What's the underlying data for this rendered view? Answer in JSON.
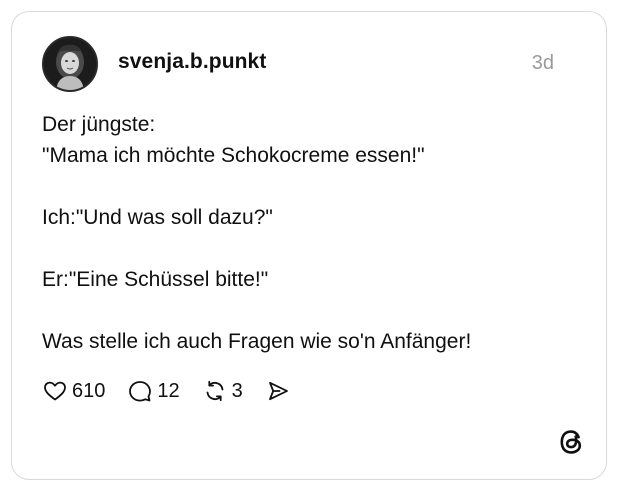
{
  "post": {
    "username": "svenja.b.punkt",
    "timestamp": "3d",
    "lines": [
      "Der jüngste:",
      "\"Mama ich möchte Schokocreme essen!\"",
      "",
      "Ich:\"Und was soll dazu?\"",
      "",
      "Er:\"Eine Schüssel bitte!\"",
      "",
      "Was stelle ich auch Fragen wie so'n Anfänger!"
    ]
  },
  "actions": {
    "likes": "610",
    "replies": "12",
    "reposts": "3"
  },
  "icons": {
    "like": "heart-icon",
    "reply": "comment-bubble-icon",
    "repost": "repost-arrows-icon",
    "share": "send-icon",
    "brand": "threads-logo-icon"
  },
  "colors": {
    "text": "#101010",
    "muted": "#999999",
    "border": "#d9d9d9"
  }
}
